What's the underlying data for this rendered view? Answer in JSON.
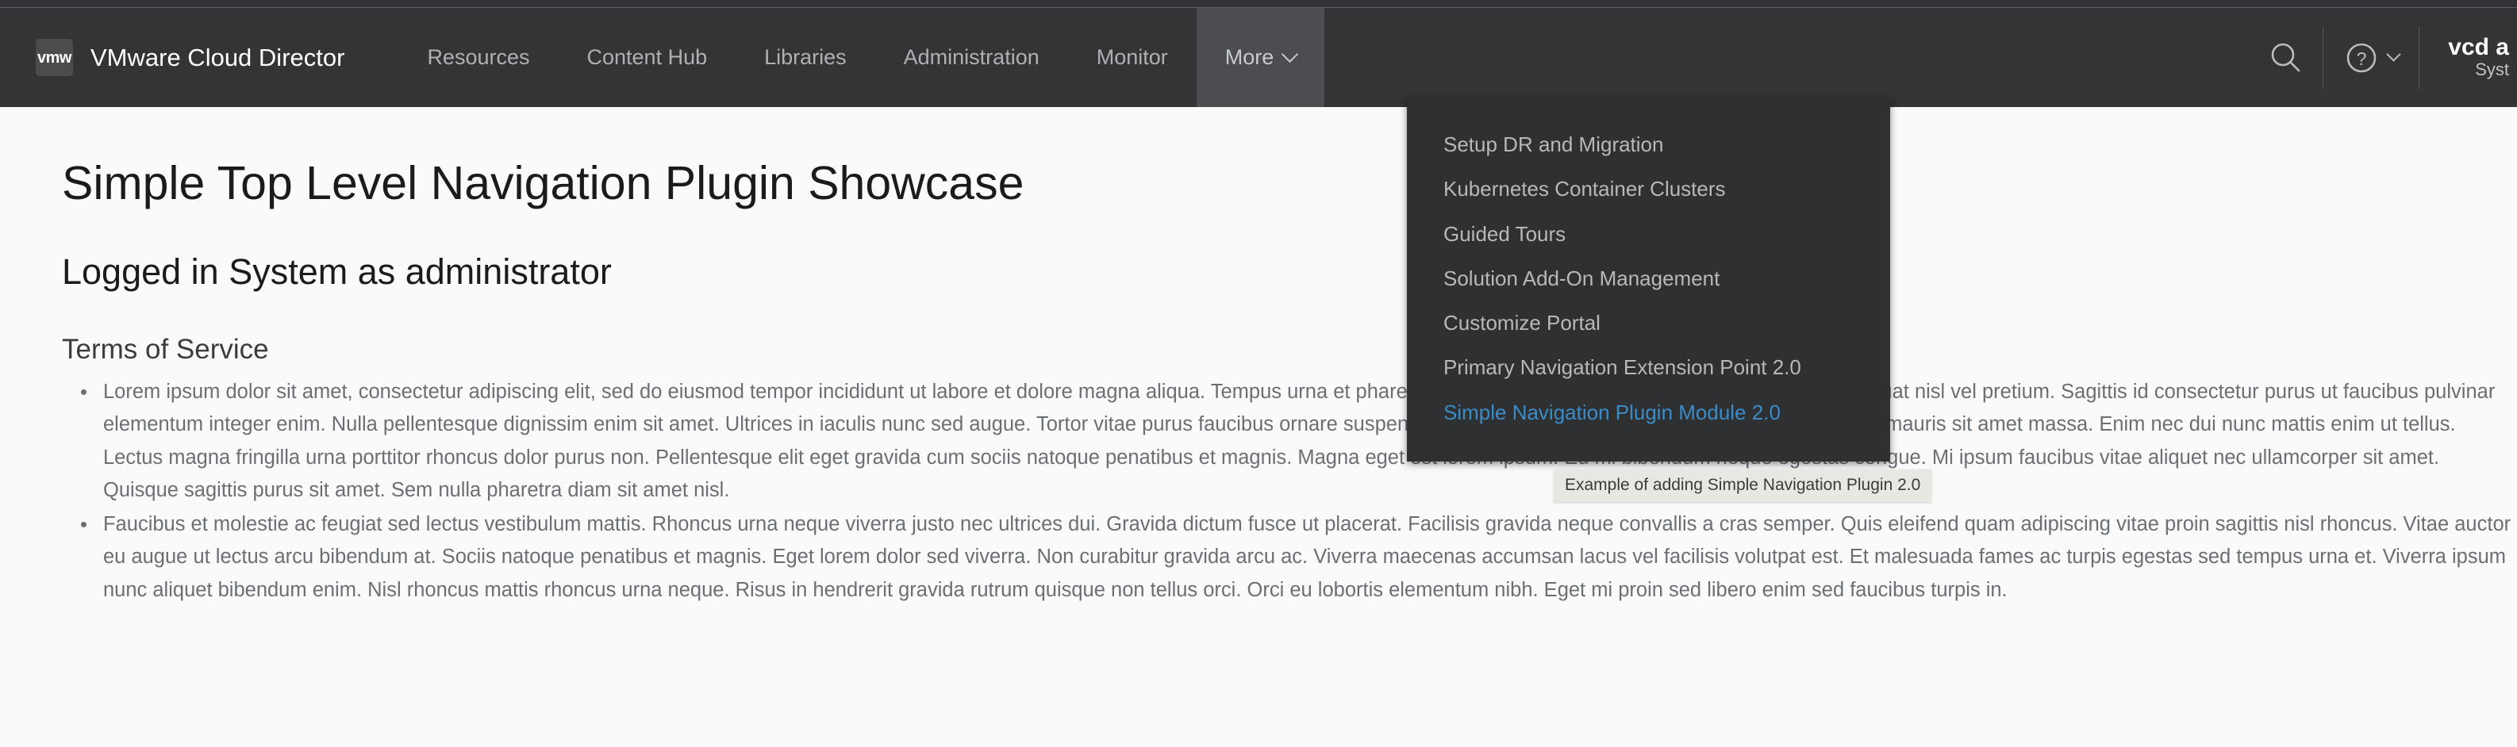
{
  "app": {
    "logo_text": "vmw",
    "title": "VMware Cloud Director"
  },
  "nav": {
    "items": [
      {
        "label": "Resources",
        "active": false
      },
      {
        "label": "Content Hub",
        "active": false
      },
      {
        "label": "Libraries",
        "active": false
      },
      {
        "label": "Administration",
        "active": false
      },
      {
        "label": "Monitor",
        "active": false
      },
      {
        "label": "More",
        "active": true
      }
    ]
  },
  "header_right": {
    "search_icon": "search-icon",
    "help_icon": "help-circle-icon",
    "user_name": "vcd a",
    "user_org": "Syst"
  },
  "dropdown": {
    "items": [
      {
        "label": "Setup DR and Migration",
        "highlight": false
      },
      {
        "label": "Kubernetes Container Clusters",
        "highlight": false
      },
      {
        "label": "Guided Tours",
        "highlight": false
      },
      {
        "label": "Solution Add-On Management",
        "highlight": false
      },
      {
        "label": "Customize Portal",
        "highlight": false
      },
      {
        "label": "Primary Navigation Extension Point 2.0",
        "highlight": false
      },
      {
        "label": "Simple Navigation Plugin Module 2.0",
        "highlight": true
      }
    ]
  },
  "tooltip": {
    "text": "Example of adding Simple Navigation Plugin 2.0"
  },
  "main": {
    "page_title": "Simple Top Level Navigation Plugin Showcase",
    "page_subtitle": "Logged in System as administrator",
    "section_heading": "Terms of Service",
    "bullets": [
      "Lorem ipsum dolor sit amet, consectetur adipiscing elit, sed do eiusmod tempor incididunt ut labore et dolore magna aliqua. Tempus urna et pharetra pharetra massa massa ultricies mi. Ipsum consequat nisl vel pretium. Sagittis id consectetur purus ut faucibus pulvinar elementum integer enim. Nulla pellentesque dignissim enim sit amet. Ultrices in iaculis nunc sed augue. Tortor vitae purus faucibus ornare suspendisse sed nisi lacus. Sagittis eu volutpat odio facilisis mauris sit amet massa. Enim nec dui nunc mattis enim ut tellus. Lectus magna fringilla urna porttitor rhoncus dolor purus non. Pellentesque elit eget gravida cum sociis natoque penatibus et magnis. Magna eget est lorem ipsum. Eu mi bibendum neque egestas congue. Mi ipsum faucibus vitae aliquet nec ullamcorper sit amet. Quisque sagittis purus sit amet. Sem nulla pharetra diam sit amet nisl.",
      "Faucibus et molestie ac feugiat sed lectus vestibulum mattis. Rhoncus urna neque viverra justo nec ultrices dui. Gravida dictum fusce ut placerat. Facilisis gravida neque convallis a cras semper. Quis eleifend quam adipiscing vitae proin sagittis nisl rhoncus. Vitae auctor eu augue ut lectus arcu bibendum at. Sociis natoque penatibus et magnis. Eget lorem dolor sed viverra. Non curabitur gravida arcu ac. Viverra maecenas accumsan lacus vel facilisis volutpat est. Et malesuada fames ac turpis egestas sed tempus urna et. Viverra ipsum nunc aliquet bibendum enim. Nisl rhoncus mattis rhoncus urna neque. Risus in hendrerit gravida rutrum quisque non tellus orci. Orci eu lobortis elementum nibh. Eget mi proin sed libero enim sed faucibus turpis in."
    ]
  },
  "colors": {
    "header_bg": "#333436",
    "header_active": "#4b4d50",
    "dropdown_bg": "#2f3032",
    "accent_link": "#3b8bc7",
    "tooltip_bg": "#e9e7e2",
    "page_bg": "#fafafa",
    "body_text": "#6b6f73"
  }
}
